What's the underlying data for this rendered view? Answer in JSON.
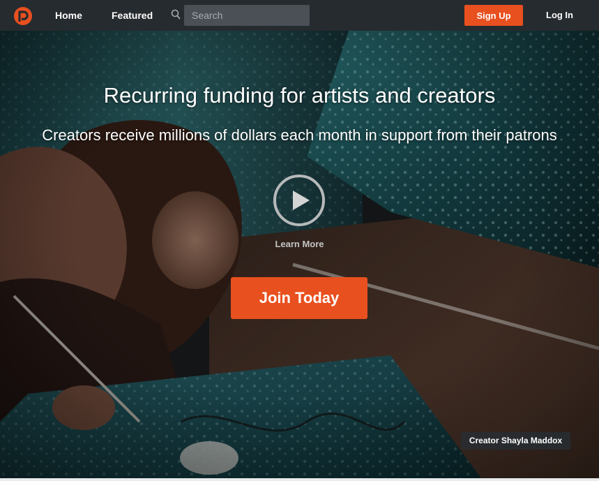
{
  "nav": {
    "home_label": "Home",
    "featured_label": "Featured",
    "search_placeholder": "Search",
    "signup_label": "Sign Up",
    "login_label": "Log In"
  },
  "hero": {
    "title": "Recurring funding for artists and creators",
    "subtitle": "Creators receive millions of dollars each month in support from their patrons",
    "learn_more_label": "Learn More",
    "join_label": "Join Today",
    "credit": "Creator Shayla Maddox"
  },
  "icons": {
    "logo": "patreon-logo-icon",
    "search": "search-icon",
    "play": "play-icon"
  },
  "colors": {
    "accent": "#e8501f",
    "navbar": "#262b2f",
    "search_field": "#4a5056"
  }
}
